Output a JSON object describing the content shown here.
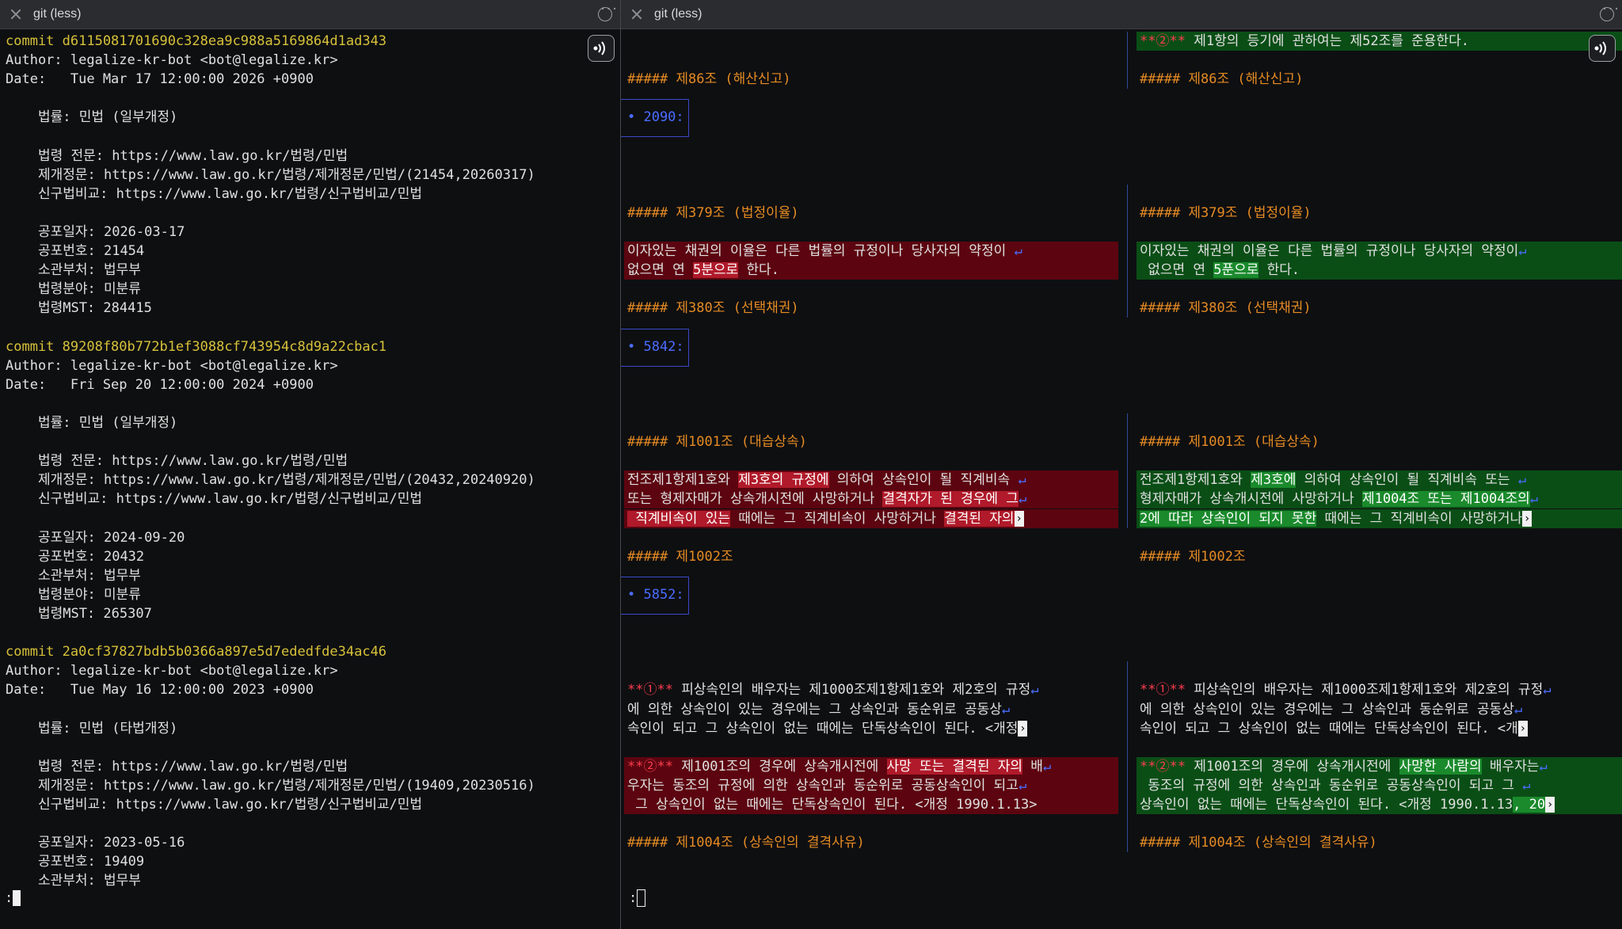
{
  "left_tab": {
    "title": "git (less)"
  },
  "right_tab": {
    "title": "git (less)"
  },
  "left_lines": [
    {
      "text": "commit d6115081701690c328ea9c988a5169864d1ad343",
      "cls": "yellow"
    },
    {
      "text": "Author: legalize-kr-bot <bot@legalize.kr>",
      "cls": "white"
    },
    {
      "text": "Date:   Tue Mar 17 12:00:00 2026 +0900",
      "cls": "white"
    },
    {
      "text": "",
      "cls": "white"
    },
    {
      "text": "    법률: 민법 (일부개정)",
      "cls": "white"
    },
    {
      "text": "",
      "cls": "white"
    },
    {
      "text": "    법령 전문: https://www.law.go.kr/법령/민법",
      "cls": "white"
    },
    {
      "text": "    제개정문: https://www.law.go.kr/법령/제개정문/민법/(21454,20260317)",
      "cls": "white"
    },
    {
      "text": "    신구법비교: https://www.law.go.kr/법령/신구법비교/민법",
      "cls": "white"
    },
    {
      "text": "",
      "cls": "white"
    },
    {
      "text": "    공포일자: 2026-03-17",
      "cls": "white"
    },
    {
      "text": "    공포번호: 21454",
      "cls": "white"
    },
    {
      "text": "    소관부처: 법무부",
      "cls": "white"
    },
    {
      "text": "    법령분야: 미분류",
      "cls": "white"
    },
    {
      "text": "    법령MST: 284415",
      "cls": "white"
    },
    {
      "text": "",
      "cls": "white"
    },
    {
      "text": "commit 89208f80b772b1ef3088cf743954c8d9a22cbac1",
      "cls": "yellow"
    },
    {
      "text": "Author: legalize-kr-bot <bot@legalize.kr>",
      "cls": "white"
    },
    {
      "text": "Date:   Fri Sep 20 12:00:00 2024 +0900",
      "cls": "white"
    },
    {
      "text": "",
      "cls": "white"
    },
    {
      "text": "    법률: 민법 (일부개정)",
      "cls": "white"
    },
    {
      "text": "",
      "cls": "white"
    },
    {
      "text": "    법령 전문: https://www.law.go.kr/법령/민법",
      "cls": "white"
    },
    {
      "text": "    제개정문: https://www.law.go.kr/법령/제개정문/민법/(20432,20240920)",
      "cls": "white"
    },
    {
      "text": "    신구법비교: https://www.law.go.kr/법령/신구법비교/민법",
      "cls": "white"
    },
    {
      "text": "",
      "cls": "white"
    },
    {
      "text": "    공포일자: 2024-09-20",
      "cls": "white"
    },
    {
      "text": "    공포번호: 20432",
      "cls": "white"
    },
    {
      "text": "    소관부처: 법무부",
      "cls": "white"
    },
    {
      "text": "    법령분야: 미분류",
      "cls": "white"
    },
    {
      "text": "    법령MST: 265307",
      "cls": "white"
    },
    {
      "text": "",
      "cls": "white"
    },
    {
      "text": "commit 2a0cf37827bdb5b0366a897e5d7ededfde34ac46",
      "cls": "yellow"
    },
    {
      "text": "Author: legalize-kr-bot <bot@legalize.kr>",
      "cls": "white"
    },
    {
      "text": "Date:   Tue May 16 12:00:00 2023 +0900",
      "cls": "white"
    },
    {
      "text": "",
      "cls": "white"
    },
    {
      "text": "    법률: 민법 (타법개정)",
      "cls": "white"
    },
    {
      "text": "",
      "cls": "white"
    },
    {
      "text": "    법령 전문: https://www.law.go.kr/법령/민법",
      "cls": "white"
    },
    {
      "text": "    제개정문: https://www.law.go.kr/법령/제개정문/민법/(19409,20230516)",
      "cls": "white"
    },
    {
      "text": "    신구법비교: https://www.law.go.kr/법령/신구법비교/민법",
      "cls": "white"
    },
    {
      "text": "",
      "cls": "white"
    },
    {
      "text": "    공포일자: 2023-05-16",
      "cls": "white"
    },
    {
      "text": "    공포번호: 19409",
      "cls": "white"
    },
    {
      "text": "    소관부처: 법무부",
      "cls": "white"
    }
  ],
  "left_prompt": ":",
  "right_prompt": ":",
  "hunk_labels": [
    "2090:",
    "5842:",
    "5852:"
  ],
  "diff_left": {
    "top_line": [],
    "h86": "##### 제86조 (해산신고)",
    "h379": "##### 제379조 (법정이율)",
    "r379_1": [
      [
        "이자있는 채권의 이율은 다른 법률의 규정이나 당사자의 약정이 ",
        ""
      ],
      [
        "↵",
        "wrap"
      ]
    ],
    "r379_2": [
      [
        "없으면 연 ",
        ""
      ],
      [
        "5분으로",
        "hl"
      ],
      [
        " 한다.",
        ""
      ]
    ],
    "h380": "##### 제380조 (선택채권)",
    "h1001": "##### 제1001조 (대습상속)",
    "r1001_1": [
      [
        "전조제1항제1호와 ",
        ""
      ],
      [
        "제3호의 규정에",
        "hl"
      ],
      [
        " 의하여 상속인이 될 직계비속 ",
        ""
      ],
      [
        "↵",
        "wrap"
      ]
    ],
    "r1001_2": [
      [
        "또는 형제자매가 상속개시전에 사망하거나 ",
        ""
      ],
      [
        "결격자가 된 경우에 그",
        "hl"
      ],
      [
        "↵",
        "wrap"
      ]
    ],
    "r1001_3": [
      [
        " 직계비속이 있는",
        "hl"
      ],
      [
        " 때에는 그 직계비속이 사망하거나 ",
        ""
      ],
      [
        "결격된 자의",
        "hl"
      ]
    ],
    "h1002": "##### 제1002조",
    "p1_1": [
      [
        "**①**",
        "red"
      ],
      [
        " 피상속인의 배우자는 제1000조제1항제1호와 제2호의 규정",
        ""
      ],
      [
        "↵",
        "wrap"
      ]
    ],
    "p1_2": [
      [
        "에 의한 상속인이 있는 경우에는 그 상속인과 동순위로 공동상",
        ""
      ],
      [
        "↵",
        "wrap"
      ]
    ],
    "p1_3": [
      [
        "속인이 되고 그 상속인이 없는 때에는 단독상속인이 된다. <개정",
        ""
      ]
    ],
    "r2_1": [
      [
        "**②**",
        "red"
      ],
      [
        " 제1001조의 경우에 상속개시전에 ",
        ""
      ],
      [
        "사망 또는 결격된 자의",
        "hl"
      ],
      [
        " 배",
        ""
      ],
      [
        "↵",
        "wrap"
      ]
    ],
    "r2_2": [
      [
        "우자는 동조의 규정에 의한 상속인과 동순위로 공동상속인이 되고",
        ""
      ],
      [
        "↵",
        "wrap"
      ]
    ],
    "r2_3": [
      [
        " 그 상속인이 없는 때에는 단독상속인이 된다. <개정 1990.1.13>",
        ""
      ]
    ],
    "h1004": "##### 제1004조 (상속인의 결격사유)"
  },
  "diff_right": {
    "top_line": [
      [
        "**②**",
        "red"
      ],
      [
        " 제1항의 등기에 관하여는 제52조를 준용한다.",
        ""
      ]
    ],
    "h86": "##### 제86조 (해산신고)",
    "h379": "##### 제379조 (법정이율)",
    "r379_1": [
      [
        "이자있는 채권의 이율은 다른 법률의 규정이나 당사자의 약정이",
        ""
      ],
      [
        "↵",
        "wrap"
      ]
    ],
    "r379_2": [
      [
        " 없으면 연 ",
        ""
      ],
      [
        "5푼으로",
        "hl"
      ],
      [
        " 한다.",
        ""
      ]
    ],
    "h380": "##### 제380조 (선택채권)",
    "h1001": "##### 제1001조 (대습상속)",
    "r1001_1": [
      [
        "전조제1항제1호와 ",
        ""
      ],
      [
        "제3호에",
        "hl"
      ],
      [
        " 의하여 상속인이 될 직계비속 또는 ",
        ""
      ],
      [
        "↵",
        "wrap"
      ]
    ],
    "r1001_2": [
      [
        "형제자매가 상속개시전에 사망하거나 ",
        ""
      ],
      [
        "제1004조 또는 제1004조의",
        "hl"
      ],
      [
        "↵",
        "wrap"
      ]
    ],
    "r1001_3": [
      [
        "2에 따라 상속인이 되지 못한",
        "hl"
      ],
      [
        " 때에는 그 직계비속이 사망하거나",
        ""
      ]
    ],
    "h1002": "##### 제1002조",
    "p1_1": [
      [
        "**①**",
        "red"
      ],
      [
        " 피상속인의 배우자는 제1000조제1항제1호와 제2호의 규정",
        ""
      ],
      [
        "↵",
        "wrap"
      ]
    ],
    "p1_2": [
      [
        "에 의한 상속인이 있는 경우에는 그 상속인과 동순위로 공동상",
        ""
      ],
      [
        "↵",
        "wrap"
      ]
    ],
    "p1_3": [
      [
        "속인이 되고 그 상속인이 없는 때에는 단독상속인이 된다. <개",
        ""
      ]
    ],
    "r2_1": [
      [
        "**②**",
        "red"
      ],
      [
        " 제1001조의 경우에 상속개시전에 ",
        ""
      ],
      [
        "사망한 사람의",
        "hl"
      ],
      [
        " 배우자는",
        ""
      ],
      [
        "↵",
        "wrap"
      ]
    ],
    "r2_2": [
      [
        " 동조의 규정에 의한 상속인과 동순위로 공동상속인이 되고 그 ",
        ""
      ],
      [
        "↵",
        "wrap"
      ]
    ],
    "r2_3": [
      [
        "상속인이 없는 때에는 단독상속인이 된다. <개정 1990.1.13",
        ""
      ],
      [
        ", 20",
        "hl"
      ]
    ],
    "h1004": "##### 제1004조 (상속인의 결격사유)"
  }
}
